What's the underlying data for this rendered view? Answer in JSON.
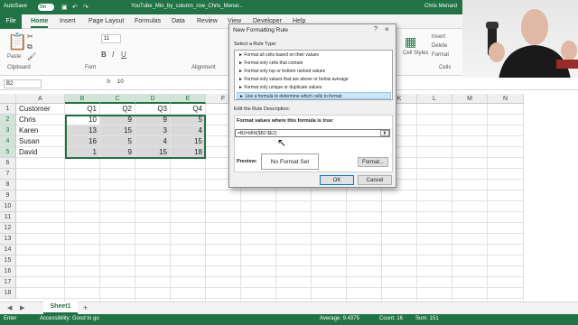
{
  "titlebar": {
    "autosave_label": "AutoSave",
    "autosave_state": "On",
    "filename": "YouTube_Min_by_column_row_Chris_Menar...",
    "user": "Chris Menard"
  },
  "tabs": [
    "File",
    "Home",
    "Insert",
    "Page Layout",
    "Formulas",
    "Data",
    "Review",
    "View",
    "Developer",
    "Help"
  ],
  "ribbon": {
    "paste_label": "Paste",
    "groups": {
      "clipboard": "Clipboard",
      "font": "Font",
      "alignment": "Alignment",
      "cells": "Cells"
    },
    "font_size": "11",
    "cells_items": [
      "Insert",
      "Delete",
      "Format"
    ],
    "cell_styles_label": "Cell Styles"
  },
  "formula_bar": {
    "name_box": "B2",
    "fx": "fx",
    "value": "10"
  },
  "grid": {
    "columns": [
      "A",
      "B",
      "C",
      "D",
      "E",
      "F",
      "G",
      "H",
      "I",
      "J",
      "K",
      "L",
      "M",
      "N"
    ],
    "rows": [
      "1",
      "2",
      "3",
      "4",
      "5",
      "6",
      "7",
      "8",
      "9",
      "10",
      "11",
      "12",
      "13",
      "14",
      "15",
      "16",
      "17",
      "18"
    ],
    "header_row": [
      "Customer",
      "Q1",
      "Q2",
      "Q3",
      "Q4"
    ],
    "data": [
      [
        "Chris",
        "10",
        "9",
        "9",
        "5"
      ],
      [
        "Karen",
        "13",
        "15",
        "3",
        "4"
      ],
      [
        "Susan",
        "16",
        "5",
        "4",
        "15"
      ],
      [
        "David",
        "1",
        "9",
        "15",
        "18"
      ]
    ]
  },
  "dialog": {
    "title": "New Formatting Rule",
    "help": "?",
    "close": "×",
    "select_rule_label": "Select a Rule Type:",
    "rule_types": [
      "► Format all cells based on their values",
      "► Format only cells that contain",
      "► Format only top or bottom ranked values",
      "► Format only values that are above or below average",
      "► Format only unique or duplicate values",
      "► Use a formula to determine which cells to format"
    ],
    "selected_rule_index": 5,
    "edit_label": "Edit the Rule Description:",
    "formula_label": "Format values where this formula is true:",
    "formula_value": "=B2=MIN($B2:$E2)",
    "preview_label": "Preview:",
    "preview_text": "No Format Set",
    "format_button": "Format...",
    "ok_button": "OK",
    "cancel_button": "Cancel"
  },
  "sheet": {
    "tab": "Sheet1",
    "add": "+"
  },
  "status": {
    "mode": "Enter",
    "accessibility": "Accessibility: Good to go",
    "average": "Average: 9.4375",
    "count": "Count: 16",
    "sum": "Sum: 151"
  },
  "colors": {
    "excel_green": "#217346",
    "highlight": "#d9d9d9"
  }
}
